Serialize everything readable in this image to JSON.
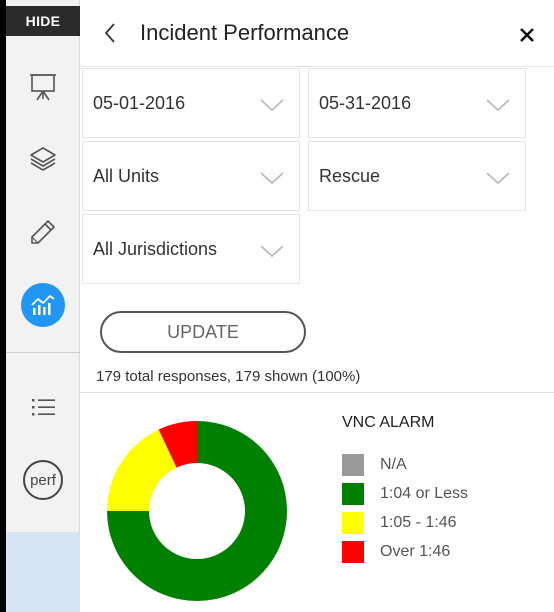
{
  "sidebar": {
    "hide_label": "HIDE",
    "items": [
      {
        "icon": "presentation-board-icon"
      },
      {
        "icon": "layers-icon"
      },
      {
        "icon": "pencil-icon"
      },
      {
        "icon": "performance-chart-icon",
        "active": true
      },
      {
        "icon": "list-icon"
      },
      {
        "icon": "perf-icon",
        "label": "perf"
      }
    ]
  },
  "panel": {
    "title": "Incident Performance",
    "filters": {
      "start_date": "05-01-2016",
      "end_date": "05-31-2016",
      "units": "All Units",
      "type": "Rescue",
      "jurisdictions": "All Jurisdictions"
    },
    "update_label": "UPDATE",
    "summary": "179 total responses, 179 shown (100%)"
  },
  "colors": {
    "accent": "#2196f3",
    "na": "#999999",
    "green": "#008000",
    "yellow": "#ffff00",
    "red": "#ff0000"
  },
  "chart_data": {
    "type": "pie",
    "title": "VNC ALARM",
    "legend": [
      "N/A",
      "1:04 or Less",
      "1:05 - 1:46",
      "Over 1:46"
    ],
    "values": [
      0,
      75,
      18,
      7
    ],
    "unit": "percent (approx.)"
  }
}
